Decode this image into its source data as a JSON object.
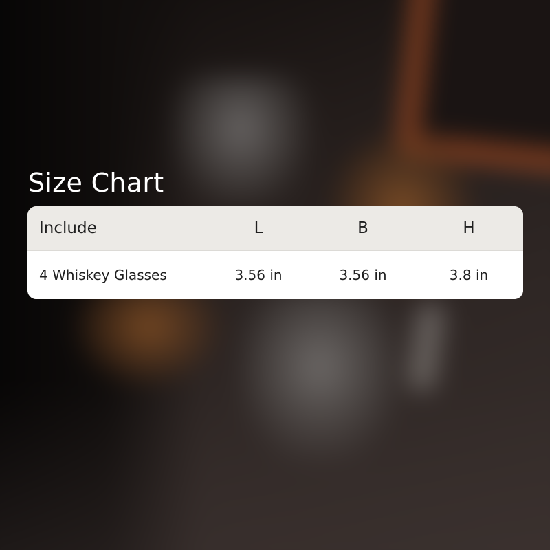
{
  "title": "Size Chart",
  "table": {
    "headers": [
      "Include",
      "L",
      "B",
      "H"
    ],
    "rows": [
      [
        "4 Whiskey Glasses",
        "3.56 in",
        "3.56 in",
        "3.8 in"
      ]
    ]
  },
  "colors": {
    "title_text": "#ffffff",
    "header_background": "#eceae6",
    "body_background": "#ffffff",
    "cell_text": "#1f1f1f"
  }
}
